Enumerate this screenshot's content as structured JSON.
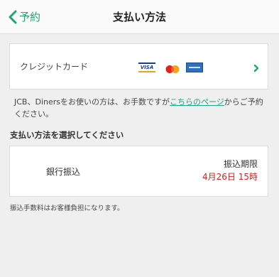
{
  "navbar": {
    "back_label": "予約",
    "title": "支払い方法"
  },
  "credit_card": {
    "label": "クレジットカード",
    "brands": [
      "VISA",
      "Mastercard",
      "American Express"
    ],
    "visa_text": "VISA"
  },
  "notice": {
    "text_before": "JCB、Dinersをお使いの方は、お手数ですが",
    "link_text": "こちらのページ",
    "text_after": "からご予約ください。"
  },
  "section": {
    "heading": "支払い方法を選択してください"
  },
  "bank_transfer": {
    "name": "銀行振込",
    "deadline_label": "振込期限",
    "deadline_value": "4月26日 15時"
  },
  "fee_note": "振込手数料はお客様負担になります。",
  "colors": {
    "accent_green": "#1aa86b",
    "link": "#17a98a",
    "deadline_red": "#d62020",
    "background": "#efefef"
  },
  "icons": {
    "back": "chevron-left-icon",
    "forward": "chevron-right-icon"
  }
}
